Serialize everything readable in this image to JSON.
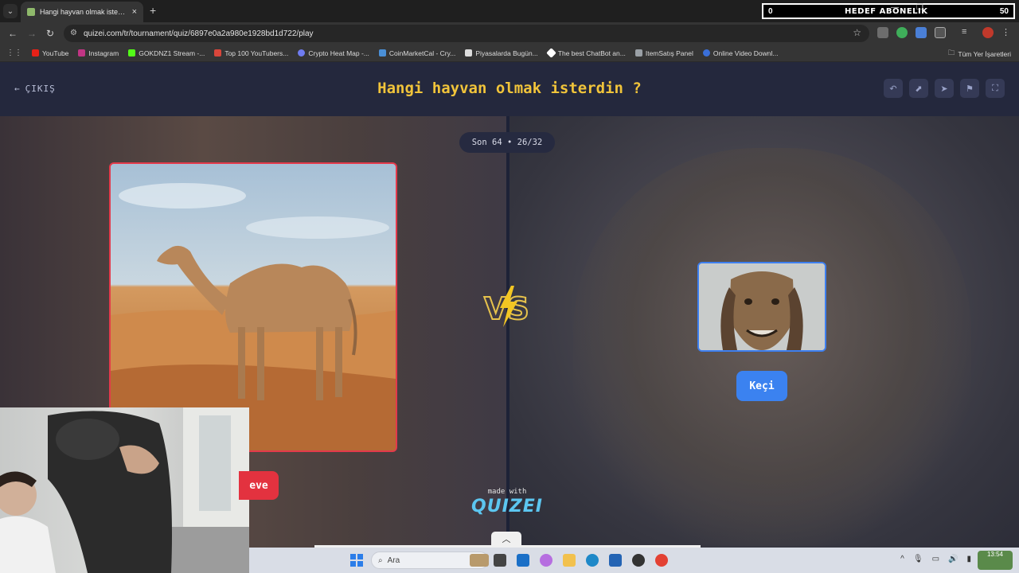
{
  "browser": {
    "tab_title": "Hangi hayvan olmak isterdin ?",
    "url": "quizei.com/tr/tournament/quiz/6897e0a2a980e1928bd1d722/play",
    "bookmarks": [
      {
        "label": "YouTube",
        "color": "#e62117"
      },
      {
        "label": "Instagram",
        "color": "#c13584"
      },
      {
        "label": "GOKDNZ1 Stream -...",
        "color": "#53fc18"
      },
      {
        "label": "Top 100 YouTubers...",
        "color": "#d9463b"
      },
      {
        "label": "Crypto Heat Map -...",
        "color": "#6f7cf0"
      },
      {
        "label": "CoinMarketCal - Cry...",
        "color": "#4a8fd6"
      },
      {
        "label": "Piyasalarda Bugün...",
        "color": "#dddddd"
      },
      {
        "label": "The best ChatBot an...",
        "color": "#ffffff"
      },
      {
        "label": "ItemSatış Panel",
        "color": "#9aa0a6"
      },
      {
        "label": "Online Video Downl...",
        "color": "#3a6fd8"
      }
    ],
    "bookmarks_right": "Tüm Yer İşaretleri"
  },
  "overlay": {
    "left_value": "0",
    "title": "HEDEF ABONELIK",
    "right_value": "50"
  },
  "page": {
    "exit_label": "ÇIKIŞ",
    "title": "Hangi hayvan olmak isterdin ?",
    "round": "Son 64 • 26/32",
    "left_choice": "eve",
    "right_choice": "Keçi",
    "made_with": "made with",
    "brand": "QUIZEI"
  },
  "taskbar": {
    "search_placeholder": "Ara",
    "clock_time": "13:54"
  },
  "colors": {
    "accent_title": "#f1c43a",
    "left_border": "#e33a4b",
    "right_border": "#3d7ff0",
    "right_button": "#3b82f0"
  }
}
